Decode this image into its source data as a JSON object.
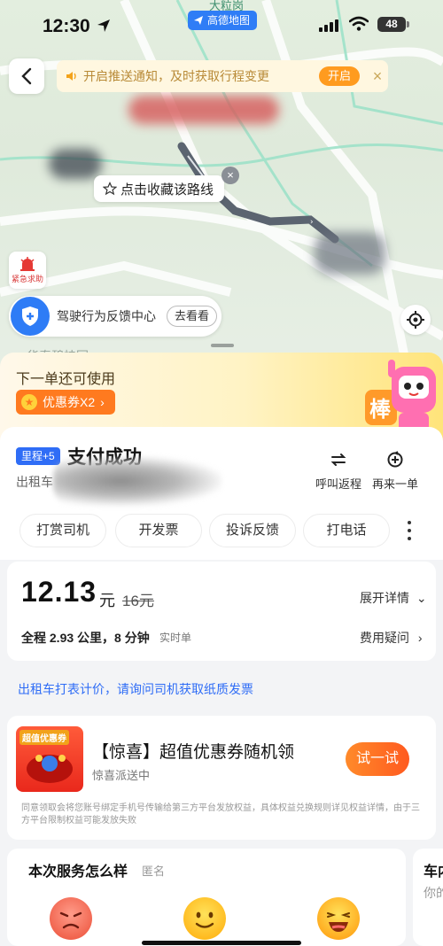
{
  "status_bar": {
    "time": "12:30",
    "battery": "48",
    "amap_badge": "高德地图"
  },
  "map": {
    "notice_text": "开启推送通知，及时获取行程变更",
    "notice_button": "开启",
    "fav_route": "点击收藏该路线",
    "sos_label": "紧急求助",
    "feedback_label": "驾驶行为反馈中心",
    "feedback_button": "去看看",
    "top_place": "大粒岗",
    "bottom_place": "华泰碧桂园"
  },
  "promo": {
    "title": "下一单还可使用",
    "coupon_label": "优惠券X2",
    "mascot_text": "棒"
  },
  "order": {
    "mileage_badge": "里程+5",
    "title": "支付成功",
    "subtitle": "出租车",
    "actions": [
      {
        "label": "呼叫返程",
        "icon": "return-trip-icon"
      },
      {
        "label": "再来一单",
        "icon": "reorder-icon"
      }
    ],
    "tabs": [
      "打赏司机",
      "开发票",
      "投诉反馈",
      "打电话"
    ]
  },
  "fare": {
    "price": "12.13",
    "unit": "元",
    "old_price": "16元",
    "detail_link": "展开详情",
    "trip_info": "全程 2.93 公里，8 分钟",
    "realtime_tag": "实时单",
    "fee_link": "费用疑问"
  },
  "taxi_note": "出租车打表计价，请询问司机获取纸质发票",
  "surprise": {
    "image_label": "超值优惠券",
    "title": "【惊喜】超值优惠券随机领",
    "subtitle": "惊喜派送中",
    "button": "试一试",
    "consent": "同意领取会将您账号绑定手机号传输给第三方平台发放权益，具体权益兑换规则详见权益详情，由于三方平台限制权益可能发放失败"
  },
  "rating": {
    "title": "本次服务怎么样",
    "anon": "匿名",
    "faces": [
      "angry-face-icon",
      "smile-face-icon",
      "laugh-face-icon"
    ]
  },
  "side_card": {
    "title": "车内",
    "sub": "你的"
  },
  "colors": {
    "accent_blue": "#2f6df6",
    "accent_orange": "#ff7a1f",
    "map_green": "#dfeadb"
  }
}
